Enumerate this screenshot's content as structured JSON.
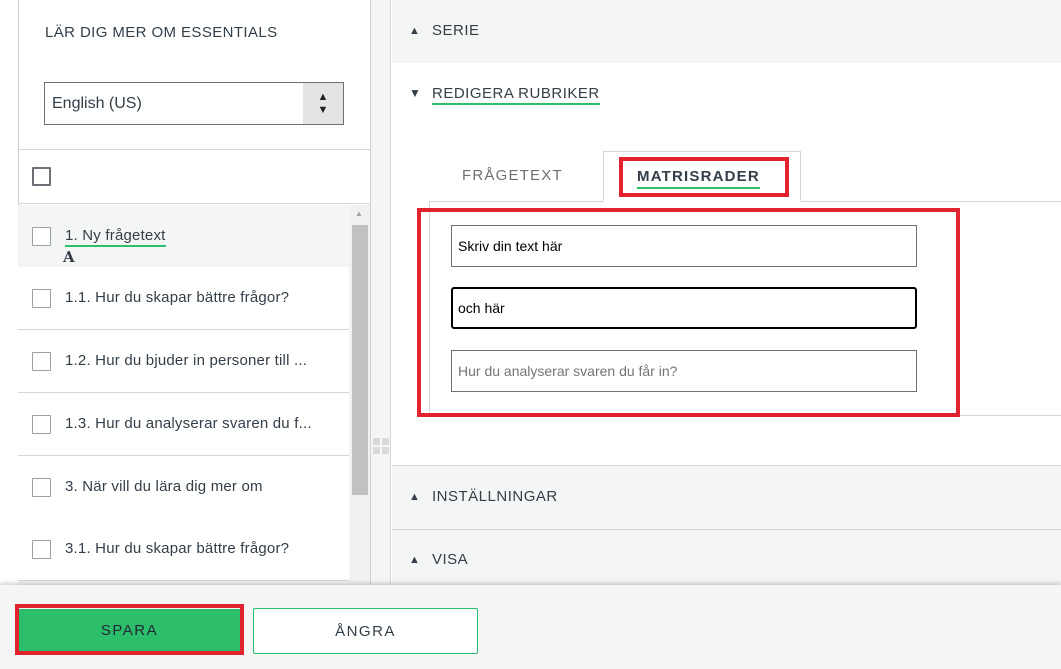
{
  "left": {
    "title": "LÄR DIG MER OM ESSENTIALS",
    "language": {
      "selected": "English (US)"
    },
    "questions": [
      {
        "text": "1.  Ny frågetext",
        "selected": true
      },
      {
        "text": "1.1.  Hur du skapar bättre frågor?"
      },
      {
        "text": "1.2.  Hur du bjuder in personer till ..."
      },
      {
        "text": "1.3.  Hur du analyserar svaren du f..."
      },
      {
        "text": "3.  När vill du lära dig mer om"
      },
      {
        "text": "3.1.  Hur du skapar bättre frågor?"
      }
    ],
    "formatting_glyph": "A"
  },
  "right": {
    "sections": {
      "serie": "SERIE",
      "edit_headings": "REDIGERA RUBRIKER",
      "settings": "INSTÄLLNINGAR",
      "view": "VISA"
    },
    "tabs": {
      "question_text": "FRÅGETEXT",
      "matrix_rows": "MATRISRADER",
      "active": "matrix_rows"
    },
    "matrix_rows": [
      {
        "value": "Skriv din text här",
        "placeholder": ""
      },
      {
        "value": "och här",
        "placeholder": ""
      },
      {
        "value": "",
        "placeholder": "Hur du analyserar svaren du får in?"
      }
    ]
  },
  "footer": {
    "save_label": "SPARA",
    "undo_label": "ÅNGRA"
  },
  "colors": {
    "accent_green": "#2dbe6c",
    "highlight_red": "#e0232e",
    "text": "#333e48"
  }
}
